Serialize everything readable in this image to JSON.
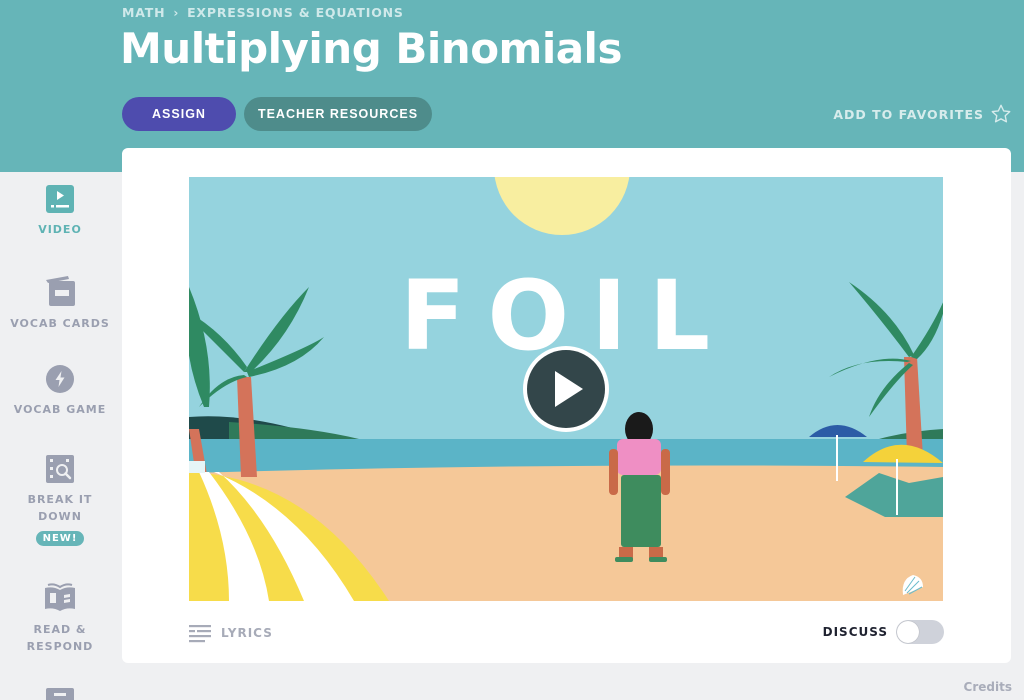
{
  "header": {
    "breadcrumb": [
      "MATH",
      "EXPRESSIONS & EQUATIONS"
    ],
    "breadcrumb_sep": "›",
    "title": "Multiplying Binomials",
    "assign_label": "ASSIGN",
    "teacher_resources_label": "TEACHER RESOURCES",
    "favorites_label": "ADD TO FAVORITES",
    "favorites_icon": "star-outline-icon"
  },
  "sidebar": {
    "items": [
      {
        "label": "VIDEO",
        "icon": "video-icon",
        "active": true
      },
      {
        "label": "VOCAB CARDS",
        "icon": "vocab-cards-icon",
        "active": false
      },
      {
        "label": "VOCAB GAME",
        "icon": "lightning-icon",
        "active": false
      },
      {
        "label": "BREAK IT DOWN",
        "icon": "break-it-down-icon",
        "active": false,
        "badge": "NEW!"
      },
      {
        "label": "READ & RESPOND",
        "icon": "open-book-icon",
        "active": false
      }
    ]
  },
  "video": {
    "overlay_text": "FOIL",
    "play_icon": "play-icon"
  },
  "footer": {
    "lyrics_label": "LYRICS",
    "discuss_label": "DISCUSS",
    "discuss_on": false,
    "credits_label": "Credits"
  },
  "colors": {
    "header_bg": "#66b5b8",
    "assign": "#4e4cae",
    "teacher": "#4e8c8b",
    "active": "#5fb3b4",
    "muted": "#9a9fb0"
  }
}
